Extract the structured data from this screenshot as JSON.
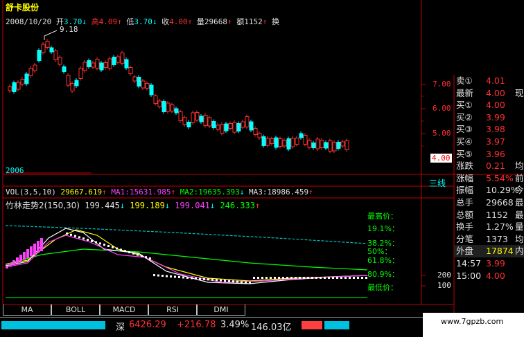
{
  "header": {
    "stock_name": "舒卡股份",
    "date": "2008/10/20",
    "open_label": "开",
    "open": "3.70",
    "high_label": "高",
    "high": "4.09",
    "low_label": "低",
    "low": "3.70",
    "close_label": "收",
    "close": "4.00",
    "vol_label": "量",
    "vol": "29668",
    "amt_label": "额",
    "amt": "1152",
    "turn_label": "换"
  },
  "price_chart": {
    "peak_label": "9.18",
    "y_ticks": [
      "7.00",
      "6.00",
      "5.00"
    ],
    "current_price_tag": "4.00",
    "year_label": "2006",
    "san_xian": "三线"
  },
  "vol_bar": {
    "label": "VOL(3,5,10)",
    "vol": "29667.619",
    "ma1": "MA1:15631.985",
    "ma2": "MA2:19635.393",
    "ma3": "MA3:18986.459"
  },
  "indicator": {
    "name": "竹林走势2(150,30)",
    "v1": "199.445",
    "v2": "199.189",
    "v3": "199.041",
    "v4": "246.333",
    "fib_high": "最高价：",
    "fib_191": "19.1%：",
    "fib_382": "38.2%：",
    "fib_50": "50%：",
    "fib_618": "61.8%：",
    "fib_809": "80.9%：",
    "fib_low": "最低价：",
    "axis_200": "200",
    "axis_100": "100"
  },
  "quote_panel": {
    "rows": [
      {
        "label": "卖①",
        "value": "4.01",
        "extra": "",
        "color": "#ff3030"
      },
      {
        "label": "最新",
        "value": "4.00",
        "extra": "现",
        "color": "#ff3030"
      },
      {
        "label": "买①",
        "value": "4.00",
        "extra": "",
        "color": "#ff3030"
      },
      {
        "label": "买②",
        "value": "3.99",
        "extra": "",
        "color": "#ff3030"
      },
      {
        "label": "买③",
        "value": "3.98",
        "extra": "",
        "color": "#ff3030"
      },
      {
        "label": "买④",
        "value": "3.97",
        "extra": "",
        "color": "#ff3030"
      },
      {
        "label": "买⑤",
        "value": "3.96",
        "extra": "",
        "color": "#ff3030"
      },
      {
        "label": "涨跌",
        "value": "0.21",
        "extra": "均",
        "color": "#ff3030"
      },
      {
        "label": "涨幅",
        "value": "5.54%",
        "extra": "前",
        "color": "#ff3030"
      },
      {
        "label": "振幅",
        "value": "10.29%",
        "extra": "今",
        "color": "#e0e0e0"
      },
      {
        "label": "总手",
        "value": "29668",
        "extra": "最",
        "color": "#e0e0e0"
      },
      {
        "label": "总额",
        "value": "1152",
        "extra": "最",
        "color": "#e0e0e0"
      },
      {
        "label": "换手",
        "value": "1.27%",
        "extra": "量",
        "color": "#e0e0e0"
      },
      {
        "label": "分笔",
        "value": "1373",
        "extra": "均",
        "color": "#e0e0e0"
      },
      {
        "label": "外盘",
        "value": "17874",
        "extra": "内",
        "color": "#ffff00"
      },
      {
        "label": "14:57",
        "value": "3.99",
        "extra": "",
        "color": "#ff3030"
      },
      {
        "label": "15:00",
        "value": "4.00",
        "extra": "",
        "color": "#ff3030"
      }
    ]
  },
  "tabs": [
    "MA",
    "BOLL",
    "MACD",
    "RSI",
    "DMI"
  ],
  "status_bar": {
    "market": "深",
    "index": "6426.29",
    "change": "+216.78",
    "pct": "3.49%",
    "amount": "146.03亿"
  },
  "watermark": "www.7gpzb.com"
}
